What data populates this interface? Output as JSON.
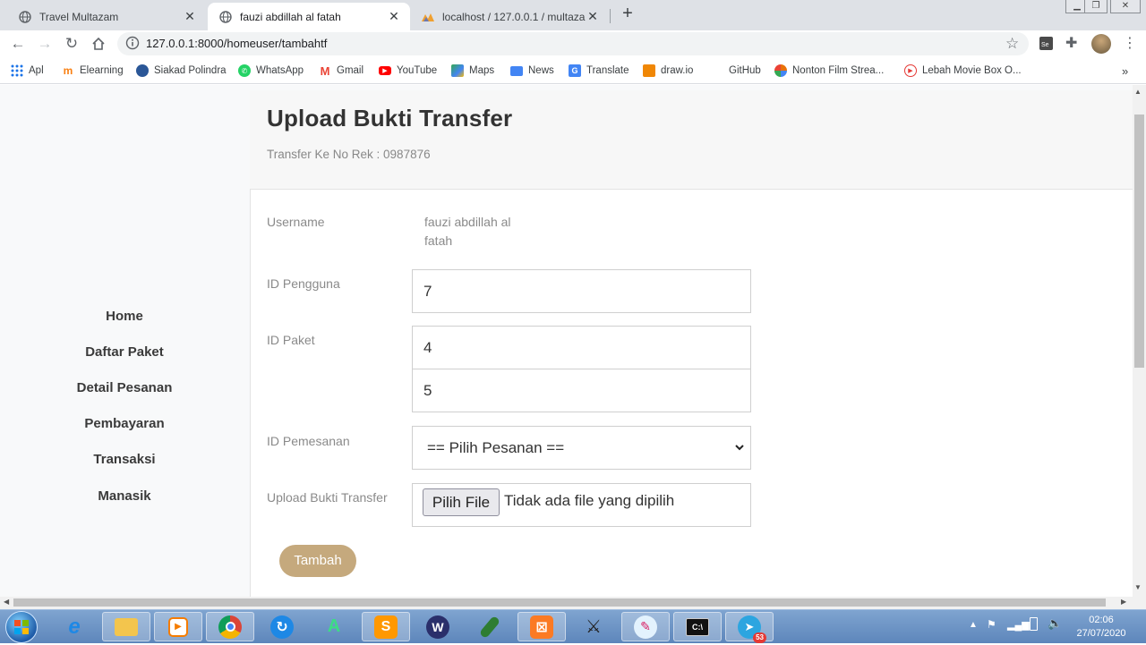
{
  "browser": {
    "tabs": [
      {
        "title": "Travel Multazam",
        "icon": "globe-icon",
        "active": false
      },
      {
        "title": "fauzi abdillah al fatah",
        "icon": "globe-icon",
        "active": true
      },
      {
        "title": "localhost / 127.0.0.1 / multazam",
        "icon": "phpmyadmin-icon",
        "active": false
      }
    ],
    "url": "127.0.0.1:8000/homeuser/tambahtf",
    "bookmarks": [
      {
        "label": "Apl",
        "icon": "apps-grid-icon",
        "color": "#1a73e8"
      },
      {
        "label": "Elearning",
        "icon": "moodle-icon",
        "color": "#f98012"
      },
      {
        "label": "Siakad Polindra",
        "icon": "university-icon",
        "color": "#2b5797"
      },
      {
        "label": "WhatsApp",
        "icon": "whatsapp-icon",
        "color": "#25d366"
      },
      {
        "label": "Gmail",
        "icon": "gmail-icon",
        "color": "#ea4335"
      },
      {
        "label": "YouTube",
        "icon": "youtube-icon",
        "color": "#ff0000"
      },
      {
        "label": "Maps",
        "icon": "maps-icon",
        "color": "#34a853"
      },
      {
        "label": "News",
        "icon": "news-icon",
        "color": "#4285f4"
      },
      {
        "label": "Translate",
        "icon": "translate-icon",
        "color": "#4285f4"
      },
      {
        "label": "draw.io",
        "icon": "drawio-icon",
        "color": "#f08705"
      },
      {
        "label": "GitHub",
        "icon": "github-icon",
        "color": "#ffffff"
      },
      {
        "label": "Nonton Film Strea...",
        "icon": "film-icon",
        "color": "#e8710a"
      },
      {
        "label": "Lebah Movie Box O...",
        "icon": "play-icon",
        "color": "#e53935"
      }
    ]
  },
  "sidebar": {
    "items": [
      "Home",
      "Daftar Paket",
      "Detail Pesanan",
      "Pembayaran",
      "Transaksi",
      "Manasik"
    ]
  },
  "form": {
    "title": "Upload Bukti Transfer",
    "subtitle": "Transfer Ke No Rek : 0987876",
    "username_label": "Username",
    "username_value": "fauzi abdillah al fatah",
    "id_pengguna_label": "ID Pengguna",
    "id_pengguna_value": "7",
    "id_paket_label": "ID Paket",
    "id_paket_values": [
      "4",
      "5"
    ],
    "id_pemesanan_label": "ID Pemesanan",
    "id_pemesanan_selected": "== Pilih Pesanan ==",
    "upload_label": "Upload Bukti Transfer",
    "file_button": "Pilih File",
    "file_status": "Tidak ada file yang dipilih",
    "submit_label": "Tambah",
    "accent_color": "#c5a97d"
  },
  "taskbar": {
    "time": "02:06",
    "date": "27/07/2020",
    "telegram_badge": "53",
    "apps": [
      "start-orb-icon",
      "internet-explorer-icon",
      "file-explorer-icon",
      "media-player-icon",
      "chrome-icon",
      "sync-icon",
      "android-studio-icon",
      "sublime-text-icon",
      "wamp-icon",
      "paint-tool-icon",
      "xampp-icon",
      "counter-strike-icon",
      "paint-icon",
      "cmd-icon",
      "telegram-icon"
    ]
  }
}
